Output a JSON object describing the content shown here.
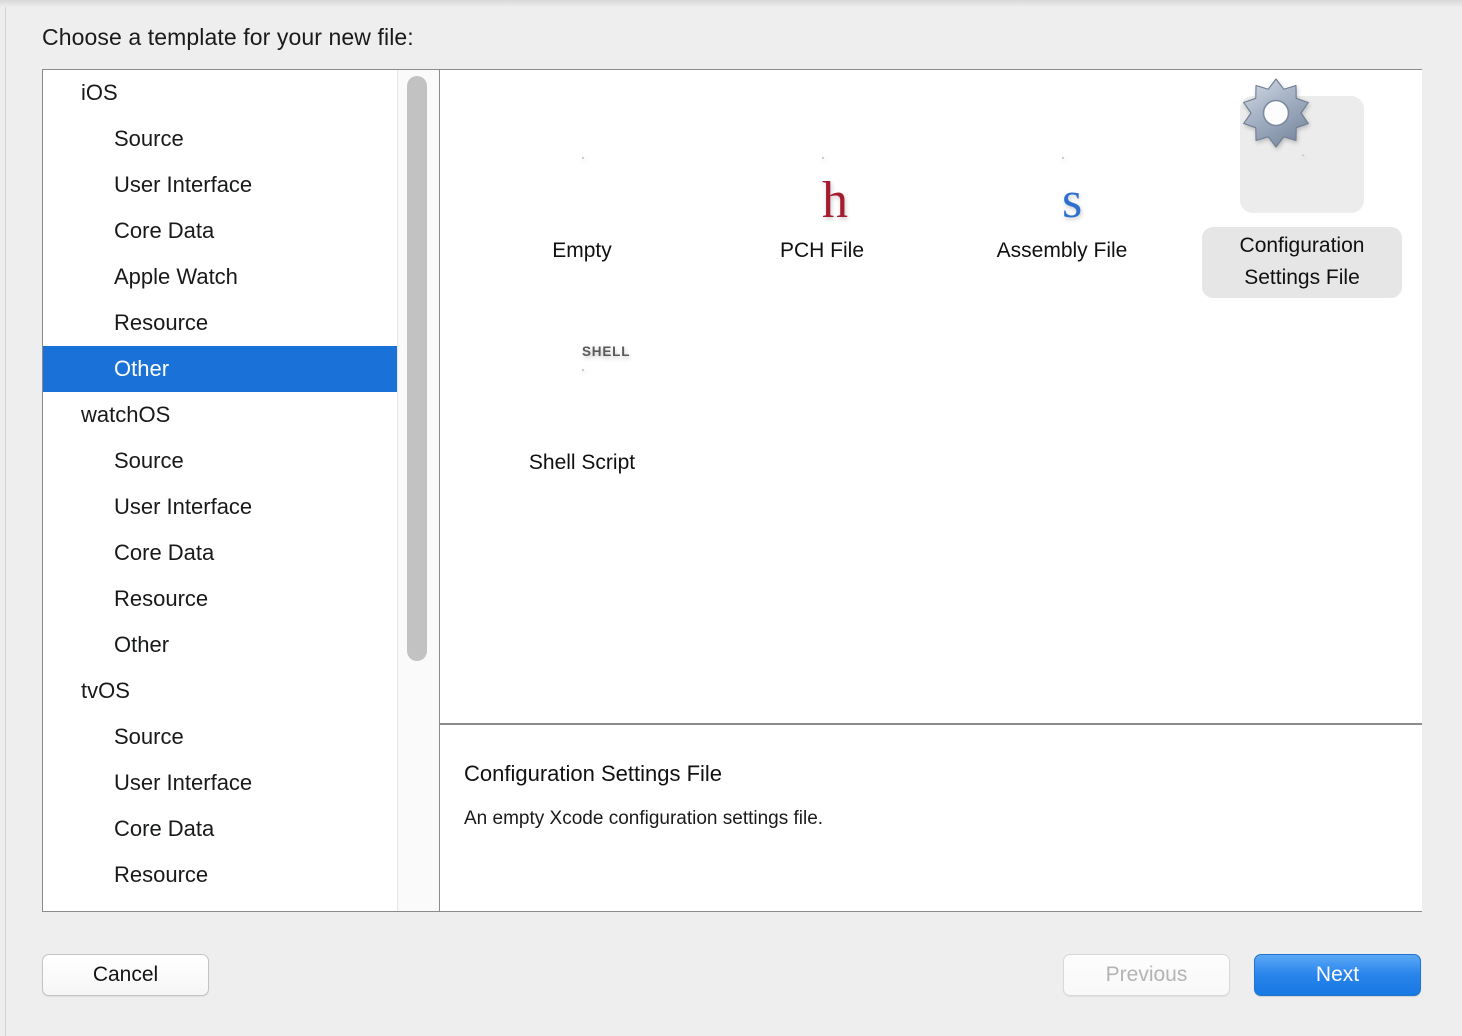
{
  "dialog": {
    "title": "Choose a template for your new file:"
  },
  "sidebar": {
    "items": [
      {
        "label": "iOS",
        "level": "group",
        "selected": false
      },
      {
        "label": "Source",
        "level": "child",
        "selected": false
      },
      {
        "label": "User Interface",
        "level": "child",
        "selected": false
      },
      {
        "label": "Core Data",
        "level": "child",
        "selected": false
      },
      {
        "label": "Apple Watch",
        "level": "child",
        "selected": false
      },
      {
        "label": "Resource",
        "level": "child",
        "selected": false
      },
      {
        "label": "Other",
        "level": "child",
        "selected": true
      },
      {
        "label": "watchOS",
        "level": "group",
        "selected": false
      },
      {
        "label": "Source",
        "level": "child",
        "selected": false
      },
      {
        "label": "User Interface",
        "level": "child",
        "selected": false
      },
      {
        "label": "Core Data",
        "level": "child",
        "selected": false
      },
      {
        "label": "Resource",
        "level": "child",
        "selected": false
      },
      {
        "label": "Other",
        "level": "child",
        "selected": false
      },
      {
        "label": "tvOS",
        "level": "group",
        "selected": false
      },
      {
        "label": "Source",
        "level": "child",
        "selected": false
      },
      {
        "label": "User Interface",
        "level": "child",
        "selected": false
      },
      {
        "label": "Core Data",
        "level": "child",
        "selected": false
      },
      {
        "label": "Resource",
        "level": "child",
        "selected": false
      }
    ],
    "selected_label": "Other",
    "scrollbar": "vertical-scrollbar"
  },
  "templates": [
    {
      "label": "Empty",
      "icon": "blank-document-icon",
      "selected": false
    },
    {
      "label": "PCH File",
      "icon": "h-document-icon",
      "selected": false
    },
    {
      "label": "Assembly File",
      "icon": "s-document-icon",
      "selected": false
    },
    {
      "label": "Configuration Settings File",
      "icon": "gear-document-icon",
      "selected": true
    },
    {
      "label": "Shell Script",
      "icon": "shell-document-icon",
      "selected": false
    }
  ],
  "description": {
    "title": "Configuration Settings File",
    "body": "An empty Xcode configuration settings file."
  },
  "footer": {
    "cancel_label": "Cancel",
    "previous_label": "Previous",
    "next_label": "Next"
  },
  "colors": {
    "selection_blue": "#1a72d8",
    "default_button_blue": "#2a85ec",
    "window_background": "#eeeeee",
    "panel_border": "#8c8c8c",
    "pch_glyph_red": "#a51c30",
    "assembly_glyph_blue": "#2f6fd0",
    "tile_selection_gray": "#e6e6e6"
  }
}
